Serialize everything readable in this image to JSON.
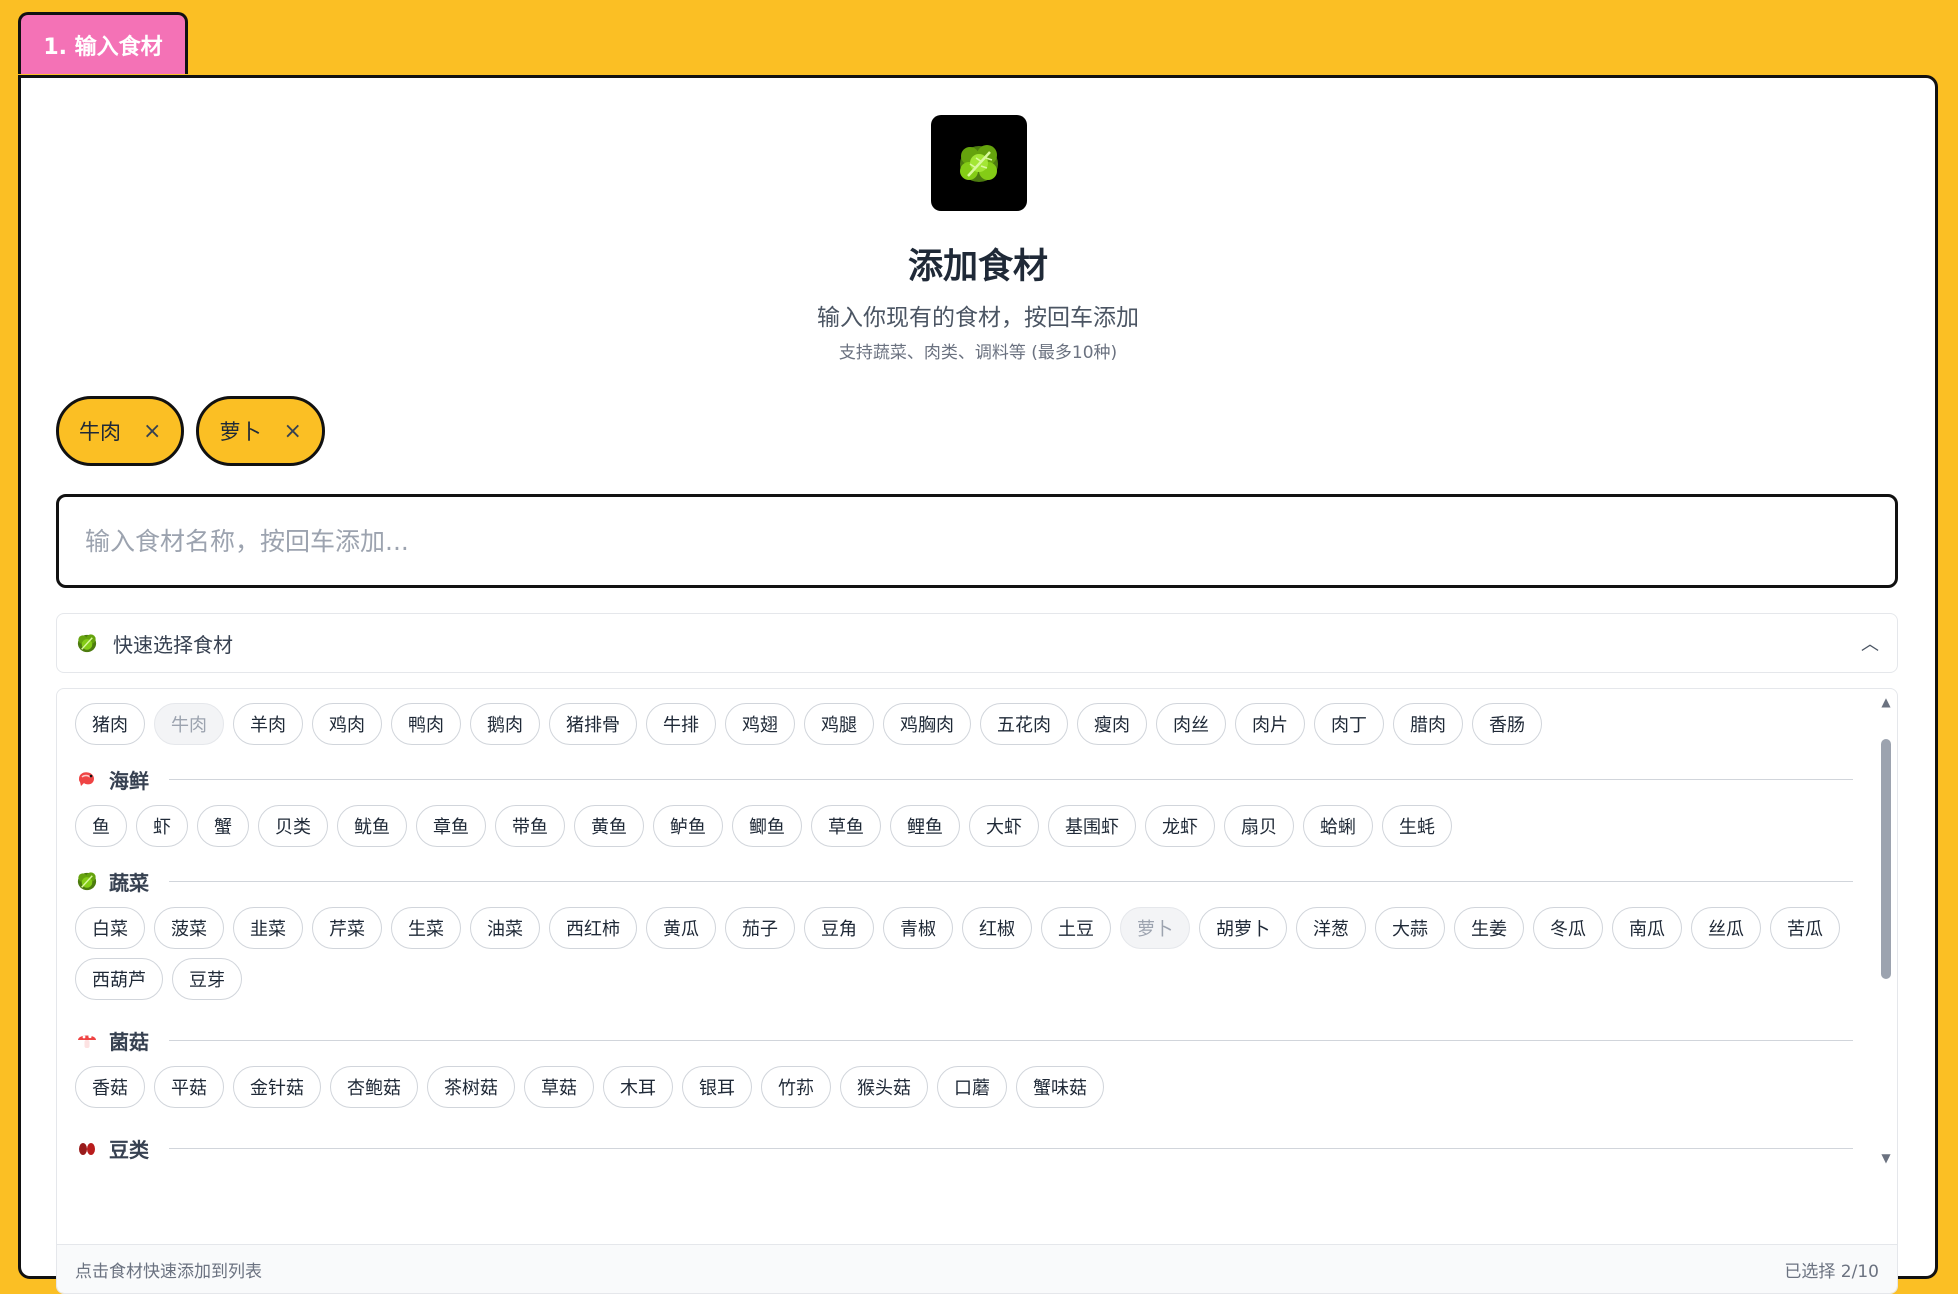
{
  "step_tab": "1. 输入食材",
  "hero": {
    "icon": "leafy-green-icon",
    "title": "添加食材",
    "subtitle": "输入你现有的食材，按回车添加",
    "note": "支持蔬菜、肉类、调料等 (最多10种)"
  },
  "selected": [
    {
      "label": "牛肉",
      "remove": "×"
    },
    {
      "label": "萝卜",
      "remove": "×"
    }
  ],
  "input": {
    "value": "",
    "placeholder": "输入食材名称，按回车添加..."
  },
  "quick_select": {
    "label": "快速选择食材",
    "icon": "leafy-green-icon",
    "chevron": "︿"
  },
  "categories": {
    "meat": {
      "items": [
        "猪肉",
        "牛肉",
        "羊肉",
        "鸡肉",
        "鸭肉",
        "鹅肉",
        "猪排骨",
        "牛排",
        "鸡翅",
        "鸡腿",
        "鸡胸肉",
        "五花肉",
        "瘦肉",
        "肉丝",
        "肉片",
        "肉丁",
        "腊肉",
        "香肠"
      ],
      "disabled": [
        "牛肉"
      ]
    },
    "seafood": {
      "name": "海鲜",
      "icon": "shrimp-icon",
      "items": [
        "鱼",
        "虾",
        "蟹",
        "贝类",
        "鱿鱼",
        "章鱼",
        "带鱼",
        "黄鱼",
        "鲈鱼",
        "鲫鱼",
        "草鱼",
        "鲤鱼",
        "大虾",
        "基围虾",
        "龙虾",
        "扇贝",
        "蛤蜊",
        "生蚝"
      ],
      "disabled": []
    },
    "vegetables": {
      "name": "蔬菜",
      "icon": "leafy-green-icon",
      "items": [
        "白菜",
        "菠菜",
        "韭菜",
        "芹菜",
        "生菜",
        "油菜",
        "西红柿",
        "黄瓜",
        "茄子",
        "豆角",
        "青椒",
        "红椒",
        "土豆",
        "萝卜",
        "胡萝卜",
        "洋葱",
        "大蒜",
        "生姜",
        "冬瓜",
        "南瓜",
        "丝瓜",
        "苦瓜",
        "西葫芦",
        "豆芽"
      ],
      "disabled": [
        "萝卜"
      ]
    },
    "mushrooms": {
      "name": "菌菇",
      "icon": "mushroom-icon",
      "items": [
        "香菇",
        "平菇",
        "金针菇",
        "杏鲍菇",
        "茶树菇",
        "草菇",
        "木耳",
        "银耳",
        "竹荪",
        "猴头菇",
        "口蘑",
        "蟹味菇"
      ],
      "disabled": []
    },
    "beans": {
      "name": "豆类",
      "icon": "beans-icon"
    }
  },
  "footer": {
    "hint": "点击食材快速添加到列表",
    "count": "已选择 2/10"
  },
  "colors": {
    "background": "#FBBF24",
    "tab": "#F472B6",
    "chip_selected": "#FBBF24"
  }
}
